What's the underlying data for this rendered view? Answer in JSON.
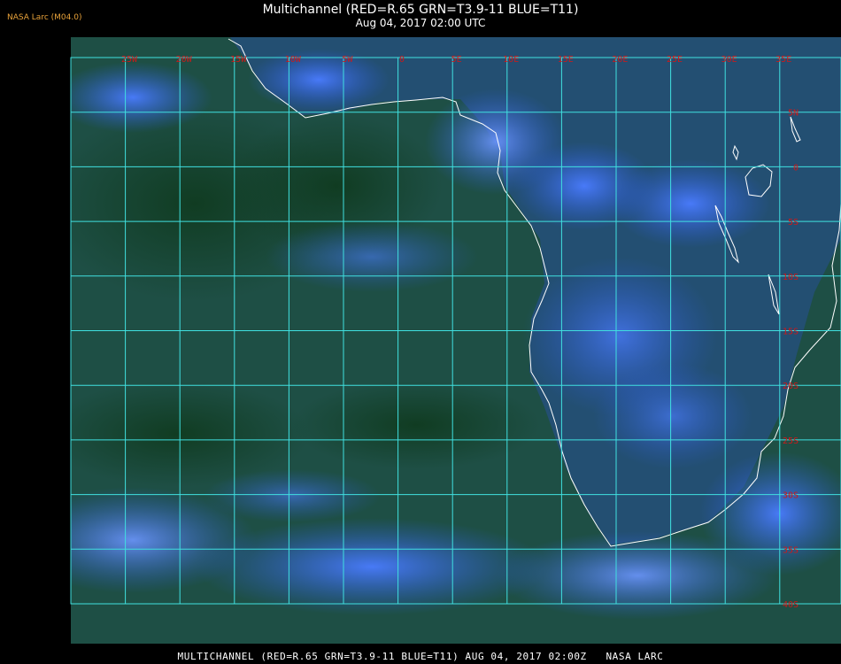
{
  "header": {
    "badge": "NASA Larc (M04.0)",
    "title": "Multichannel (RED=R.65 GRN=T3.9-11 BLUE=T11)",
    "subtitle": "Aug 04, 2017 02:00 UTC"
  },
  "footer": {
    "caption": "MULTICHANNEL (RED=R.65 GRN=T3.9-11 BLUE=T11) AUG 04, 2017 02:00Z   NASA LARC"
  },
  "map": {
    "longitude_labels": [
      "25W",
      "20W",
      "15W",
      "10W",
      "5W",
      "0",
      "5E",
      "10E",
      "15E",
      "20E",
      "25E",
      "30E",
      "35E"
    ],
    "latitude_labels": [
      "5N",
      "0",
      "5S",
      "10S",
      "15S",
      "20S",
      "25S",
      "30S",
      "35S",
      "40S"
    ],
    "colors": {
      "grid": "#40e0e0",
      "label": "#d01818",
      "coastline": "#ffffff",
      "ocean": "#1d4f3f",
      "cloud": "#2d64e8"
    }
  }
}
